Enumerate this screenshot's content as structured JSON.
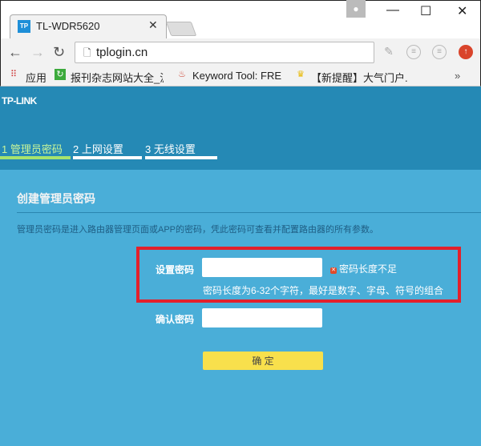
{
  "browser": {
    "tab_title": "TL-WDR5620",
    "favicon_text": "TP",
    "url": "tplogin.cn",
    "bookmarks": [
      {
        "label": "应用",
        "icon": "apps-grid-icon"
      },
      {
        "label": "报刊杂志网站大全_沪",
        "icon": "refresh-green-icon"
      },
      {
        "label": "Keyword Tool: FREE",
        "icon": "flame-icon"
      },
      {
        "label": "【新提醒】大气门户.",
        "icon": "trophy-icon"
      }
    ],
    "more": "»"
  },
  "header": {
    "logo": "TP-LINK",
    "steps": [
      {
        "label": "1 管理员密码",
        "active": true
      },
      {
        "label": "2 上网设置",
        "active": false
      },
      {
        "label": "3 无线设置",
        "active": false
      }
    ]
  },
  "form": {
    "title": "创建管理员密码",
    "description": "管理员密码是进入路由器管理页面或APP的密码，凭此密码可查看并配置路由器的所有参数。",
    "password_label": "设置密码",
    "password_value": "",
    "error": "密码长度不足",
    "hint": "密码长度为6-32个字符，最好是数字、字母、符号的组合",
    "confirm_label": "确认密码",
    "confirm_value": "",
    "submit": "确 定"
  },
  "colors": {
    "header": "#2589b5",
    "body": "#4aaed8",
    "active_step": "#a6e36e",
    "error_box": "#e3202b",
    "button": "#f8e04c"
  }
}
